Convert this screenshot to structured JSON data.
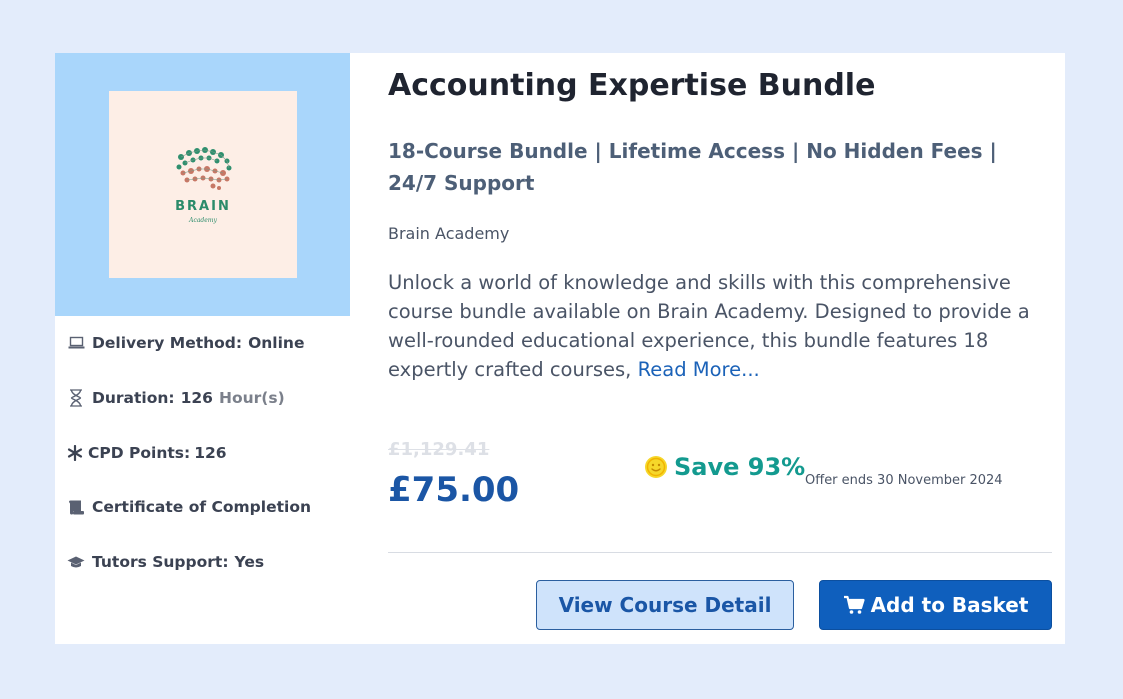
{
  "course": {
    "title": "Accounting Expertise Bundle",
    "subtitle": "18-Course Bundle | Lifetime Access | No Hidden Fees | 24/7 Support",
    "provider": "Brain Academy",
    "description": "Unlock a world of knowledge and skills with this comprehensive course bundle available on Brain Academy. Designed to provide a well-rounded educational experience, this bundle features 18 expertly crafted courses,",
    "read_more_label": "Read More..."
  },
  "logo": {
    "name": "BRAIN",
    "sub": "Academy"
  },
  "meta": {
    "delivery_label": "Delivery Method:",
    "delivery_value": "Online",
    "duration_label": "Duration:",
    "duration_value": "126",
    "duration_unit": "Hour(s)",
    "cpd_label": "CPD Points:",
    "cpd_value": "126",
    "certificate_label": "Certificate of Completion",
    "tutors_label": "Tutors Support:",
    "tutors_value": "Yes"
  },
  "pricing": {
    "old_price": "£1,129.41",
    "price": "£75.00",
    "save_label": "Save 93%",
    "offer_text": "Offer ends 30 November 2024"
  },
  "actions": {
    "view_label": "View Course Detail",
    "add_label": "Add to Basket"
  },
  "icons": {
    "delivery": "laptop-icon",
    "duration": "hourglass-icon",
    "cpd": "asterisk-icon",
    "certificate": "scroll-icon",
    "tutors": "graduation-cap-icon",
    "save": "smiley-icon",
    "cart": "cart-icon"
  },
  "colors": {
    "page_bg": "#e3ecfb",
    "thumb_bg": "#a9d6fb",
    "price": "#1b56a5",
    "save": "#139a8f",
    "primary_button": "#0f5fbd",
    "secondary_button": "#cfe3fb"
  }
}
